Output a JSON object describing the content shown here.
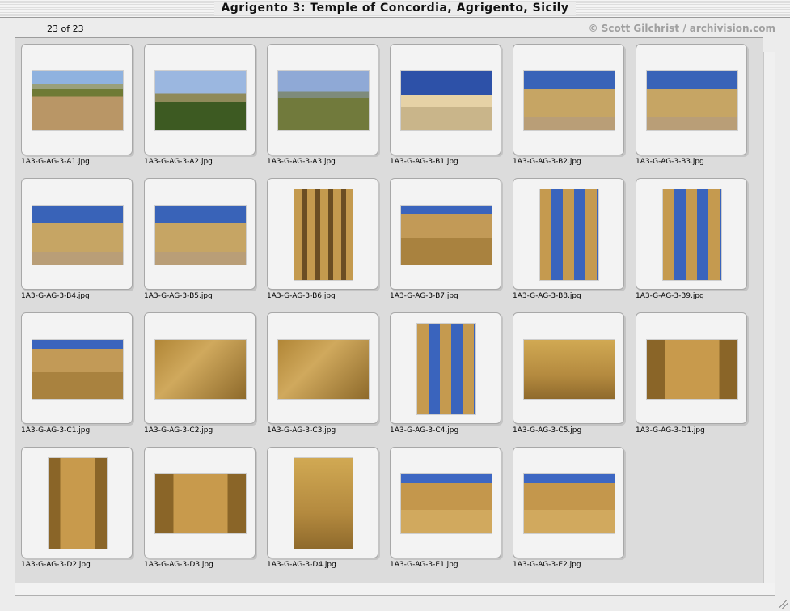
{
  "window": {
    "title": "Agrigento 3: Temple of Concordia, Agrigento, Sicily"
  },
  "info": {
    "count": "23 of 23",
    "credit": "© Scott Gilchrist / archivision.com"
  },
  "items": [
    "1A3-G-AG-3-A1.jpg",
    "1A3-G-AG-3-A2.jpg",
    "1A3-G-AG-3-A3.jpg",
    "1A3-G-AG-3-B1.jpg",
    "1A3-G-AG-3-B2.jpg",
    "1A3-G-AG-3-B3.jpg",
    "1A3-G-AG-3-B4.jpg",
    "1A3-G-AG-3-B5.jpg",
    "1A3-G-AG-3-B6.jpg",
    "1A3-G-AG-3-B7.jpg",
    "1A3-G-AG-3-B8.jpg",
    "1A3-G-AG-3-B9.jpg",
    "1A3-G-AG-3-C1.jpg",
    "1A3-G-AG-3-C2.jpg",
    "1A3-G-AG-3-C3.jpg",
    "1A3-G-AG-3-C4.jpg",
    "1A3-G-AG-3-C5.jpg",
    "1A3-G-AG-3-D1.jpg",
    "1A3-G-AG-3-D2.jpg",
    "1A3-G-AG-3-D3.jpg",
    "1A3-G-AG-3-D4.jpg",
    "1A3-G-AG-3-E1.jpg",
    "1A3-G-AG-3-E2.jpg"
  ]
}
